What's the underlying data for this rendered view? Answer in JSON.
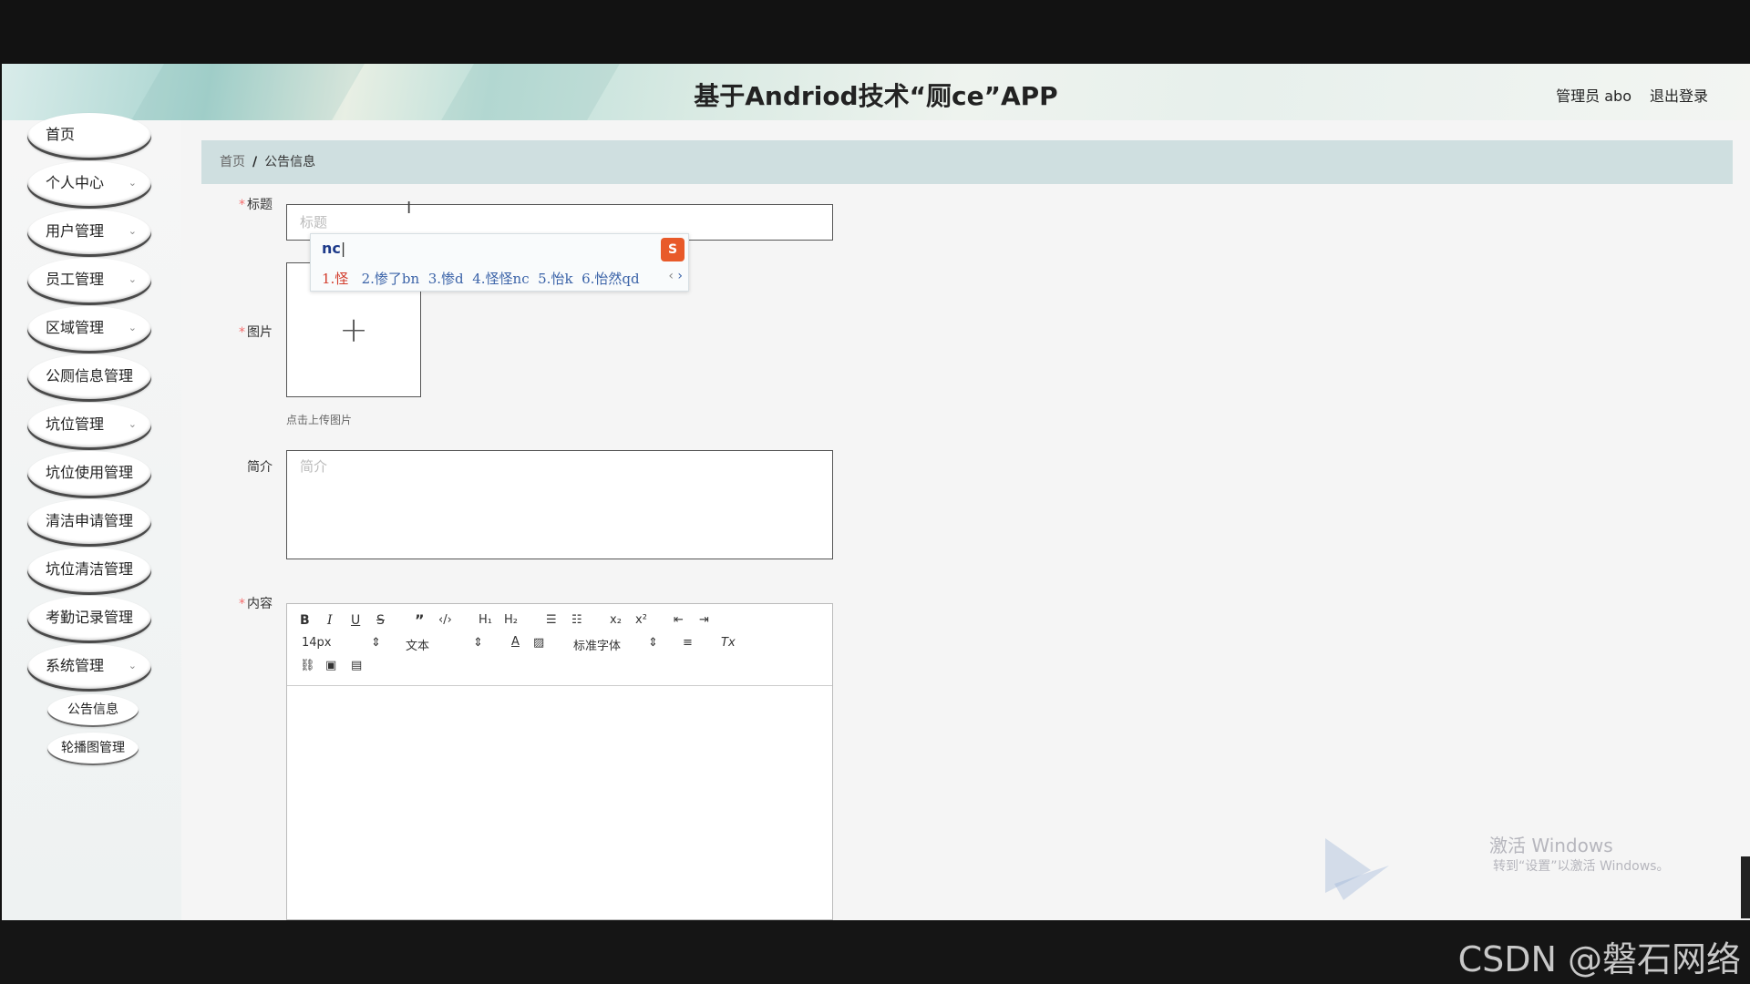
{
  "header": {
    "title": "基于Andriod技术“厕ce”APP",
    "user": "管理员 abo",
    "logout": "退出登录"
  },
  "sidebar": {
    "items": [
      {
        "label": "首页",
        "has_children": false
      },
      {
        "label": "个人中心",
        "has_children": true
      },
      {
        "label": "用户管理",
        "has_children": true
      },
      {
        "label": "员工管理",
        "has_children": true
      },
      {
        "label": "区域管理",
        "has_children": true
      },
      {
        "label": "公厕信息管理",
        "has_children": false
      },
      {
        "label": "坑位管理",
        "has_children": true
      },
      {
        "label": "坑位使用管理",
        "has_children": false
      },
      {
        "label": "清洁申请管理",
        "has_children": false
      },
      {
        "label": "坑位清洁管理",
        "has_children": false
      },
      {
        "label": "考勤记录管理",
        "has_children": false
      },
      {
        "label": "系统管理",
        "has_children": true
      }
    ],
    "sub_items": [
      {
        "label": "公告信息"
      },
      {
        "label": "轮播图管理"
      }
    ],
    "chevron": "⌄"
  },
  "breadcrumb": {
    "home": "首页",
    "separator": "/",
    "current": "公告信息"
  },
  "form": {
    "title_label": "标题",
    "title_placeholder": "标题",
    "image_label": "图片",
    "upload_hint": "点击上传图片",
    "intro_label": "简介",
    "intro_placeholder": "简介",
    "content_label": "内容",
    "required_mark": "*"
  },
  "editor": {
    "font_size": "14px",
    "text_format": "文本",
    "font_family": "标准字体"
  },
  "ime": {
    "input_code": "nc",
    "candidates": [
      "1.怪",
      "2.惨了bn",
      "3.惨d",
      "4.怪怪nc",
      "5.怡k",
      "6.怡然qd"
    ],
    "prev": "‹",
    "next": "›"
  },
  "watermark": {
    "line1": "激活 Windows",
    "line2": "转到“设置”以激活 Windows。"
  },
  "footer": {
    "csdn": "CSDN @磐石网络"
  },
  "colors": {
    "required": "#f56c6c",
    "breadcrumb_bg": "#cfdfe0",
    "ime_logo": "#e85a2a",
    "ime_candidate": "#3b63a8"
  }
}
